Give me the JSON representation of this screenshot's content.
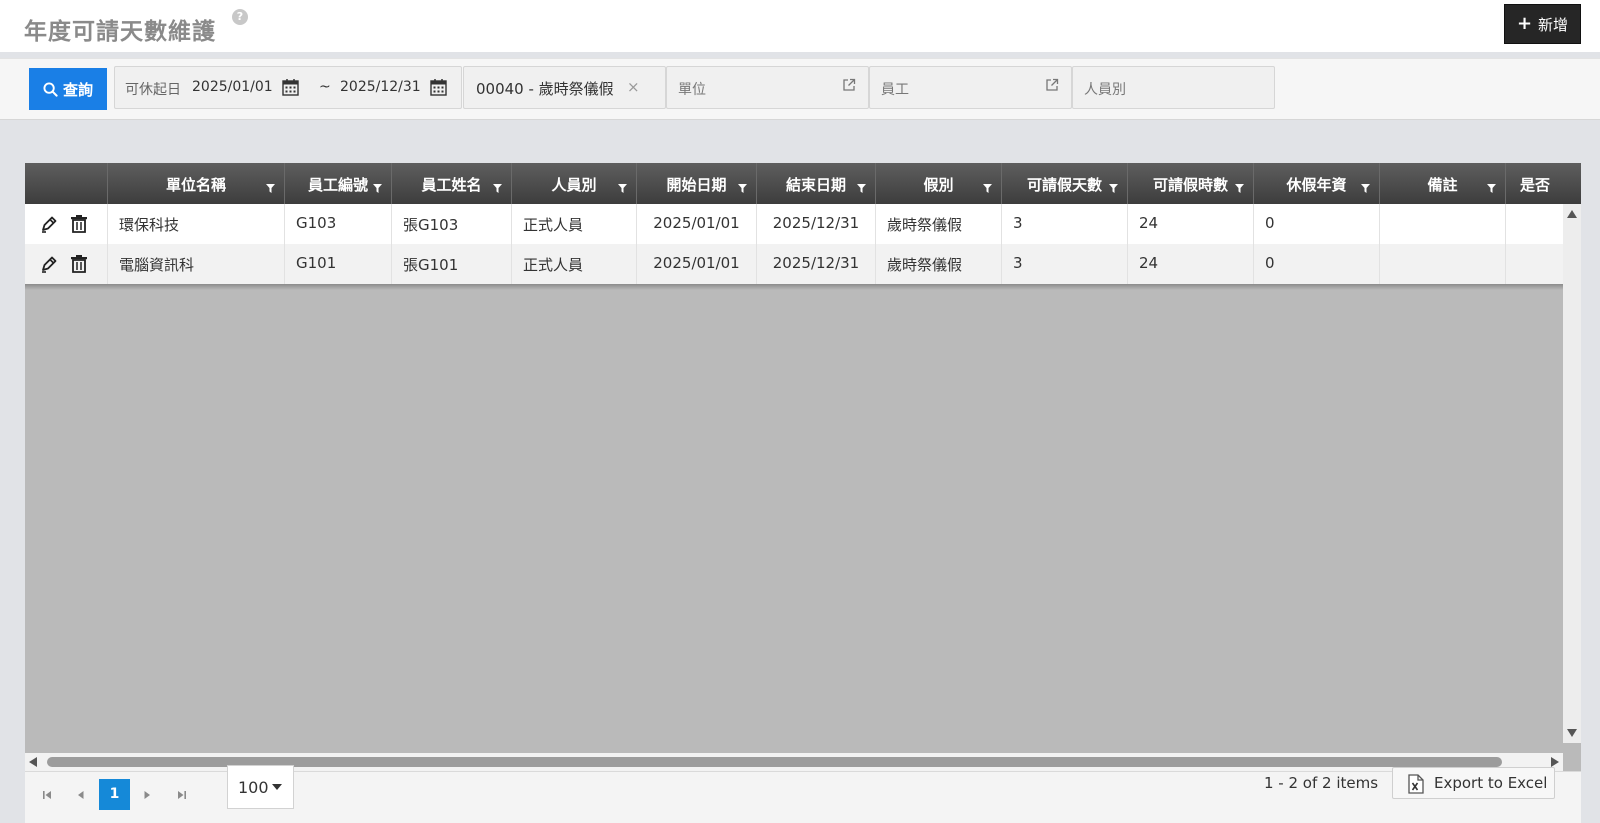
{
  "header": {
    "title": "年度可請天數維護",
    "help_icon": "?",
    "add_label": "新增"
  },
  "filters": {
    "query_label": "查詢",
    "date_label": "可休起日",
    "date_from": "2025/01/01",
    "date_sep": "~",
    "date_to": "2025/12/31",
    "leave_type_value": "00040 - 歲時祭儀假",
    "clear_symbol": "×",
    "unit_placeholder": "單位",
    "employee_placeholder": "員工",
    "person_type_placeholder": "人員別"
  },
  "grid": {
    "columns": [
      "單位名稱",
      "員工編號",
      "員工姓名",
      "人員別",
      "開始日期",
      "結束日期",
      "假別",
      "可請假天數",
      "可請假時數",
      "休假年資",
      "備註",
      "是否"
    ],
    "rows": [
      [
        "環保科技",
        "G103",
        "張G103",
        "正式人員",
        "2025/01/01",
        "2025/12/31",
        "歲時祭儀假",
        "3",
        "24",
        "0",
        "",
        ""
      ],
      [
        "電腦資訊科",
        "G101",
        "張G101",
        "正式人員",
        "2025/01/01",
        "2025/12/31",
        "歲時祭儀假",
        "3",
        "24",
        "0",
        "",
        ""
      ]
    ]
  },
  "pager": {
    "current_page": "1",
    "page_size": "100",
    "items_info": "1 - 2 of 2 items",
    "export_label": "Export to Excel"
  },
  "colors": {
    "primary": "#1a7fe6",
    "header_dark": "#3d3d3d",
    "page_active": "#1589d8"
  }
}
